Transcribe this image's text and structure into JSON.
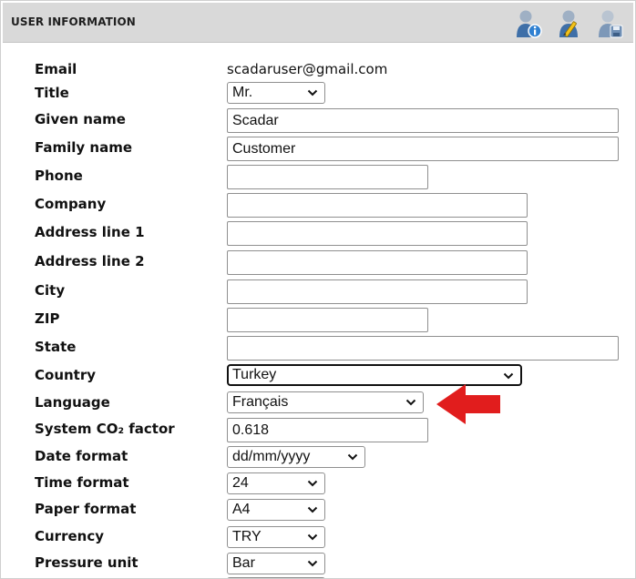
{
  "header": {
    "title": "USER INFORMATION"
  },
  "icons": {
    "user_info": "user-info-icon",
    "user_edit": "user-edit-icon",
    "user_save": "user-save-icon"
  },
  "colors": {
    "header_bg": "#d9d9d9",
    "icon_blue": "#3e6fa8",
    "arrow": "#e11d1d"
  },
  "form": {
    "email": {
      "label": "Email",
      "value": "scadaruser@gmail.com"
    },
    "title": {
      "label": "Title",
      "selected": "Mr."
    },
    "given_name": {
      "label": "Given name",
      "value": "Scadar"
    },
    "family_name": {
      "label": "Family name",
      "value": "Customer"
    },
    "phone": {
      "label": "Phone",
      "value": ""
    },
    "company": {
      "label": "Company",
      "value": ""
    },
    "address1": {
      "label": "Address line 1",
      "value": ""
    },
    "address2": {
      "label": "Address line 2",
      "value": ""
    },
    "city": {
      "label": "City",
      "value": ""
    },
    "zip": {
      "label": "ZIP",
      "value": ""
    },
    "state": {
      "label": "State",
      "value": ""
    },
    "country": {
      "label": "Country",
      "selected": "Turkey"
    },
    "language": {
      "label": "Language",
      "selected": "Français"
    },
    "co2": {
      "label": "System CO₂ factor",
      "value": "0.618"
    },
    "date_format": {
      "label": "Date format",
      "selected": "dd/mm/yyyy"
    },
    "time_format": {
      "label": "Time format",
      "selected": "24"
    },
    "paper_format": {
      "label": "Paper format",
      "selected": "A4"
    },
    "currency": {
      "label": "Currency",
      "selected": "TRY"
    },
    "pressure_unit": {
      "label": "Pressure unit",
      "selected": "Bar"
    }
  }
}
